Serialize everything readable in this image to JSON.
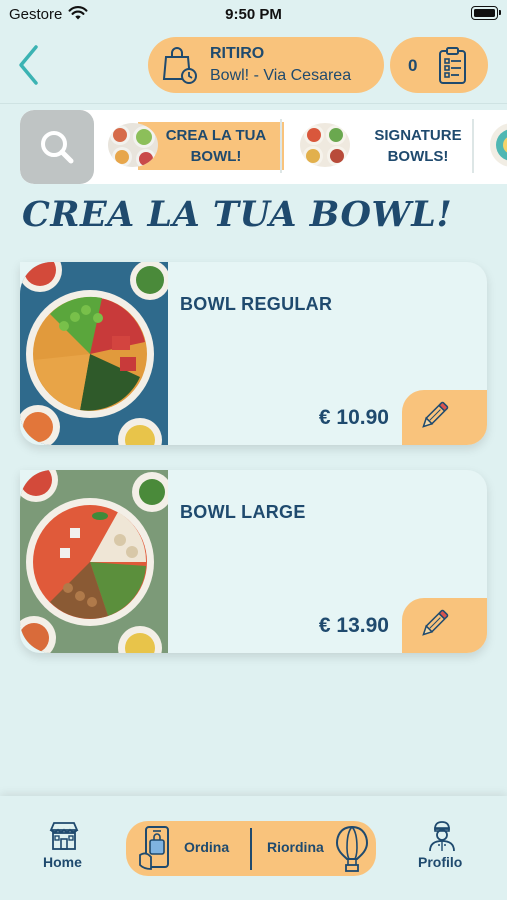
{
  "status_bar": {
    "carrier": "Gestore",
    "time": "9:50 PM"
  },
  "header": {
    "pickup_mode": "RITIRO",
    "store": "Bowl! - Via Cesarea",
    "cart_count": "0"
  },
  "categories": [
    {
      "label": "CREA LA TUA BOWL!",
      "selected": true
    },
    {
      "label": "SIGNATURE BOWLS!",
      "selected": false
    }
  ],
  "section_title": "CREA LA TUA BOWL!",
  "products": [
    {
      "name": "BOWL REGULAR",
      "price": "€ 10.90"
    },
    {
      "name": "BOWL LARGE",
      "price": "€ 13.90"
    }
  ],
  "tabbar": {
    "home": "Home",
    "order": "Ordina",
    "reorder": "Riordina",
    "profile": "Profilo"
  },
  "colors": {
    "background": "#dff1f1",
    "accent": "#f9c37c",
    "text": "#1f4a6e",
    "back_arrow": "#3bb3b3"
  },
  "icons": [
    "wifi-icon",
    "battery-icon",
    "back-arrow-icon",
    "shopping-bag-clock-icon",
    "clipboard-list-icon",
    "search-icon",
    "pencil-icon",
    "store-icon",
    "phone-order-icon",
    "hot-air-balloon-icon",
    "chef-profile-icon"
  ]
}
